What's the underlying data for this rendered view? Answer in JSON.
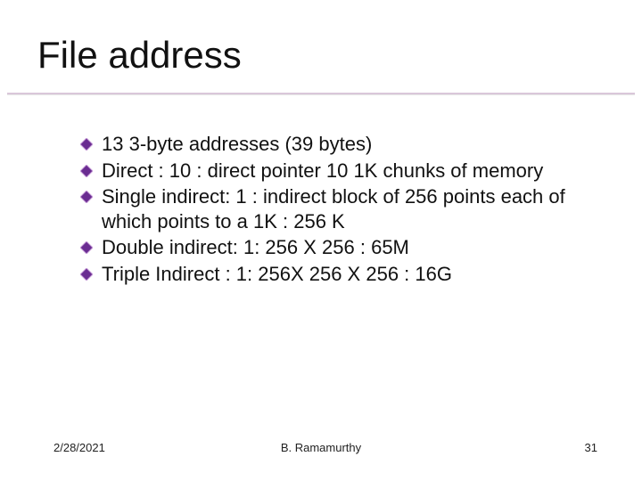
{
  "title": "File address",
  "bullets": [
    "13 3-byte addresses (39 bytes)",
    "Direct : 10  : direct pointer 10 1K chunks of memory",
    "Single indirect: 1  : indirect block of 256 points each of which points to a 1K : 256 K",
    "Double indirect: 1: 256 X 256 : 65M",
    "Triple Indirect : 1: 256X 256 X 256 : 16G"
  ],
  "footer": {
    "date": "2/28/2021",
    "author": "B. Ramamurthy",
    "page": "31"
  },
  "colors": {
    "bullet_fill": "#6a2c91",
    "bullet_stroke": "#c9a0d9",
    "rule": "#d9c7d9"
  }
}
